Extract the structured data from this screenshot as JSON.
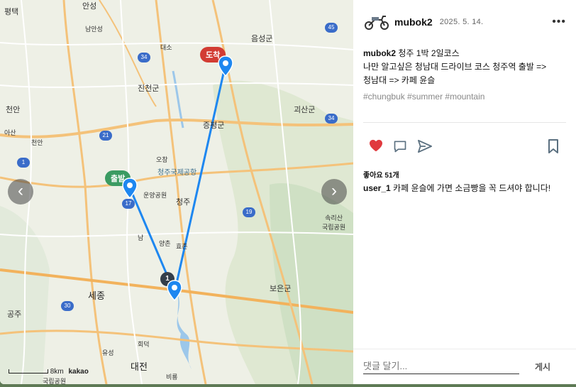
{
  "map": {
    "labels": [
      {
        "text": "평택",
        "cls": ""
      },
      {
        "text": "안성",
        "cls": ""
      },
      {
        "text": "남안성",
        "cls": ""
      },
      {
        "text": "대소",
        "cls": ""
      },
      {
        "text": "음성군",
        "cls": ""
      },
      {
        "text": "진천군",
        "cls": ""
      },
      {
        "text": "천안",
        "cls": ""
      },
      {
        "text": "괴산군",
        "cls": ""
      },
      {
        "text": "증평군",
        "cls": ""
      },
      {
        "text": "천안",
        "cls": ""
      },
      {
        "text": "아산",
        "cls": ""
      },
      {
        "text": "오창",
        "cls": ""
      },
      {
        "text": "청주국제공항",
        "cls": ""
      },
      {
        "text": "운양공원",
        "cls": ""
      },
      {
        "text": "청주",
        "cls": ""
      },
      {
        "text": "남",
        "cls": ""
      },
      {
        "text": "양촌",
        "cls": ""
      },
      {
        "text": "효촌",
        "cls": ""
      },
      {
        "text": "속리산\n국립공원",
        "cls": ""
      },
      {
        "text": "보은군",
        "cls": ""
      },
      {
        "text": "세종",
        "cls": "big"
      },
      {
        "text": "공주",
        "cls": ""
      },
      {
        "text": "유성",
        "cls": ""
      },
      {
        "text": "대전",
        "cls": "big"
      },
      {
        "text": "비룡",
        "cls": ""
      },
      {
        "text": "회덕",
        "cls": ""
      },
      {
        "text": "국립공원",
        "cls": ""
      }
    ],
    "shields": [
      {
        "text": "45",
        "color": "blue"
      },
      {
        "text": "34",
        "color": "blue"
      },
      {
        "text": "34",
        "color": "blue"
      },
      {
        "text": "21",
        "color": "blue"
      },
      {
        "text": "1",
        "color": "blue"
      },
      {
        "text": "17",
        "color": "blue"
      },
      {
        "text": "19",
        "color": "blue"
      },
      {
        "text": "30",
        "color": "blue"
      }
    ],
    "start_tag": "출발",
    "end_tag": "도착",
    "waypoint_number": "1",
    "scale_text": "8km",
    "attribution": "kakao",
    "prev": "‹",
    "next": "›"
  },
  "post": {
    "username": "mubok2",
    "date": "2025. 5. 14.",
    "more": "•••",
    "caption_user": "mubok2",
    "caption_text": "청주 1박 2일코스\n나만 알고싶은 청남대 드라이브 코스 청주역 출발 =>\n청남대 => 카페 윤슬",
    "tags": "#chungbuk #summer #mountain",
    "likes": "좋아요 51개",
    "comment_user": "user_1",
    "comment_text": " 카페 윤슬에 가면 소금빵을 꼭 드셔야 합니다!",
    "comment_placeholder": "댓글 달기...",
    "post_button": "게시"
  },
  "colors": {
    "like": "#e0393e",
    "route": "#1e87f0",
    "start": "#3a9b62",
    "end": "#d23c33"
  }
}
